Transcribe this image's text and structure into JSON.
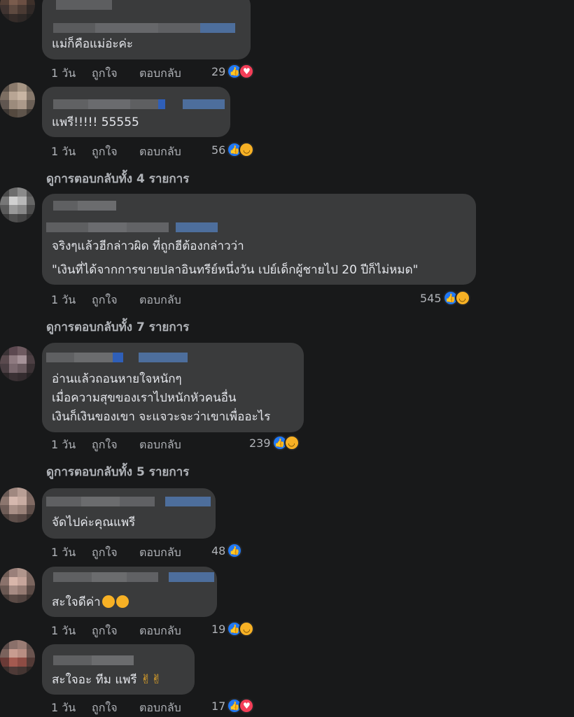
{
  "labels": {
    "like": "ถูกใจ",
    "reply": "ตอบกลับ"
  },
  "comments": [
    {
      "text": "แม่ก็คือแม่อ่ะค่ะ",
      "time": "1 วัน",
      "count": "29",
      "reactions": [
        "like-icon",
        "love-icon"
      ]
    },
    {
      "text": "แพรี!!!!! 55555",
      "time": "1 วัน",
      "count": "56",
      "reactions": [
        "like-icon",
        "haha-icon"
      ],
      "view_replies": "ดูการตอบกลับทั้ง 4 รายการ"
    },
    {
      "text1": "จริงๆแล้วฮีกล่าวผิด ที่ถูกฮีต้องกล่าวว่า",
      "text2": "\"เงินที่ได้จากการขายปลาอินทรีย์หนึ่งวัน เปย์เด็กผู้ชายไป 20 ปีก็ไม่หมด\"",
      "time": "1 วัน",
      "count": "545",
      "reactions": [
        "like-icon",
        "haha-icon"
      ],
      "view_replies": "ดูการตอบกลับทั้ง 7 รายการ"
    },
    {
      "text1": "อ่านแล้วถอนหายใจหนักๆ",
      "text2": "เมื่อความสุขของเราไปหนักหัวคนอื่น",
      "text3": "เงินก็เงินของเขา จะแจวะจะว่าเขาเพื่ออะไร",
      "time": "1 วัน",
      "count": "239",
      "reactions": [
        "like-icon",
        "haha-icon"
      ],
      "view_replies": "ดูการตอบกลับทั้ง 5 รายการ"
    },
    {
      "text": "จัดไปค่ะคุณแพรี",
      "time": "1 วัน",
      "count": "48",
      "reactions": [
        "like-icon"
      ]
    },
    {
      "text": "สะใจดีค่า",
      "time": "1 วัน",
      "count": "19",
      "reactions": [
        "like-icon",
        "haha-icon"
      ]
    },
    {
      "text": "สะใจอะ ทีม แพรี",
      "time": "1 วัน",
      "count": "17",
      "reactions": [
        "like-icon",
        "love-icon"
      ]
    }
  ],
  "colors": {
    "background": "#18191a",
    "bubble": "#3a3b3c",
    "text": "#e4e6eb",
    "muted": "#b0b3b8",
    "like": "#2078f4",
    "love": "#f33e58",
    "haha": "#f7b125"
  }
}
